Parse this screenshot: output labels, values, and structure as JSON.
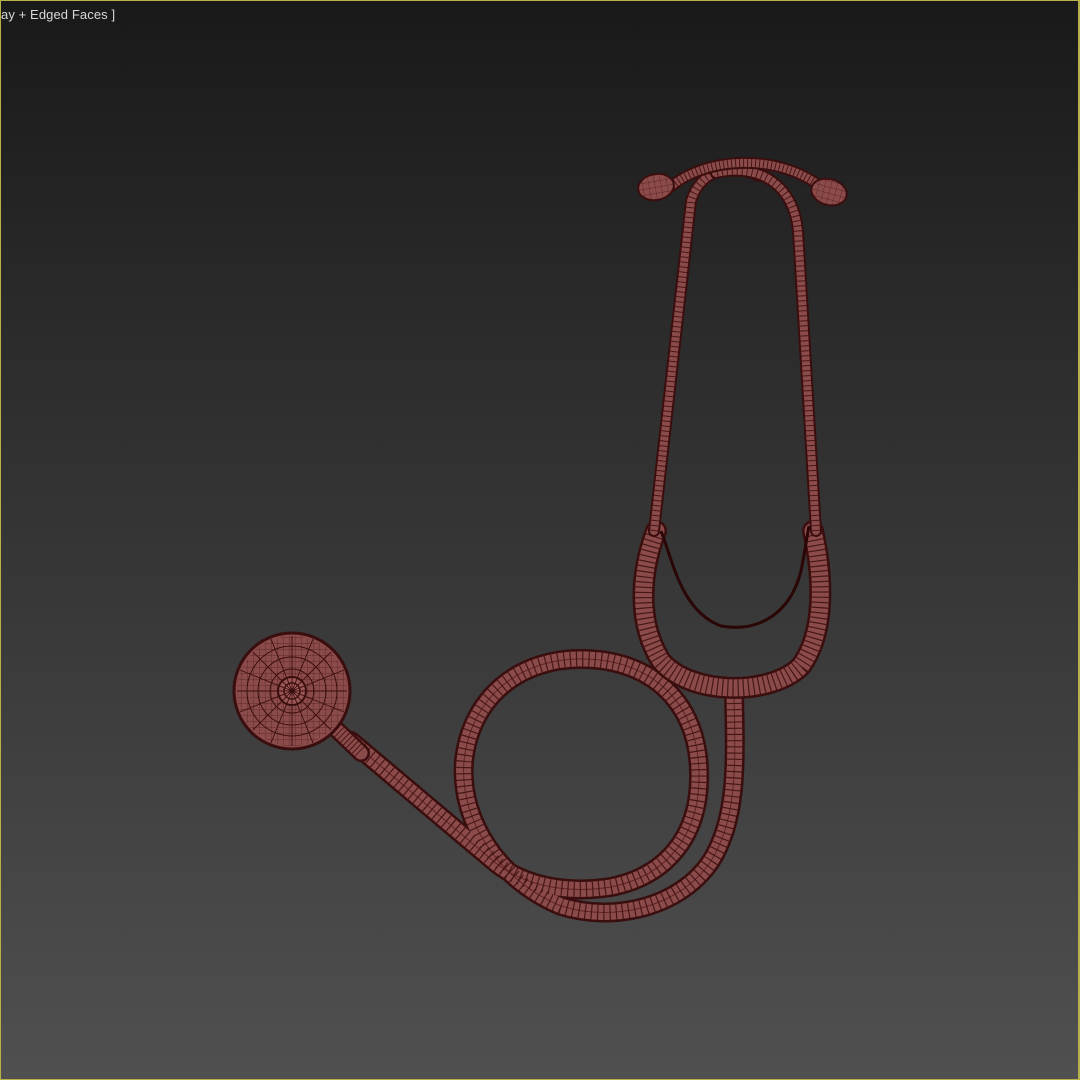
{
  "viewport": {
    "label": "ay  + Edged Faces ]"
  },
  "colors": {
    "border_active": "#b8b04a",
    "mesh_fill": "#8a4a4a",
    "mesh_edge": "#3a0e0e",
    "label_text": "#d8d8d8"
  },
  "model": {
    "name": "stethoscope",
    "icon": "stethoscope-wireframe"
  }
}
